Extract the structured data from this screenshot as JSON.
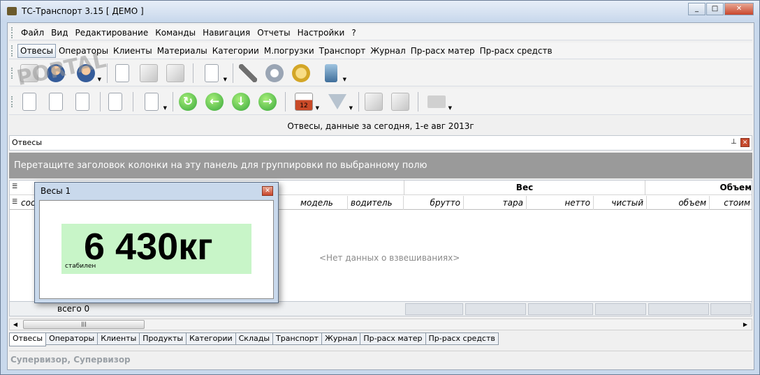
{
  "window": {
    "title": "ТС-Транспорт 3.15 [ ДЕМО ]",
    "min": "_",
    "max": "□",
    "close": "✕"
  },
  "menu": [
    "Файл",
    "Вид",
    "Редактирование",
    "Команды",
    "Навигация",
    "Отчеты",
    "Настройки",
    "?"
  ],
  "nav": [
    "Отвесы",
    "Операторы",
    "Клиенты",
    "Материалы",
    "Категории",
    "М.погрузки",
    "Транспорт",
    "Журнал",
    "Пр-расх матер",
    "Пр-расх средств"
  ],
  "header": {
    "title": "Отвесы, данные  за сегодня, 1-е авг 2013г"
  },
  "panel": {
    "caption": "Отвесы",
    "pin": "⊥",
    "close": "✕"
  },
  "group_bar": "Перетащите заголовок колонки на эту панель для группировки по выбранному полю",
  "grid": {
    "bands": {
      "ves": "Вес",
      "obj": "Объем"
    },
    "columns": [
      "сос",
      "модель",
      "водитель",
      "брутто",
      "тара",
      "нетто",
      "чистый",
      "объем",
      "стоим"
    ],
    "empty": "<Нет данных о взвешиваниях>"
  },
  "footer": {
    "total": "всего 0"
  },
  "scroll": {
    "left": "◀",
    "right": "▶",
    "grip": "|||"
  },
  "tabs": [
    "Отвесы",
    "Операторы",
    "Клиенты",
    "Продукты",
    "Категории",
    "Склады",
    "Транспорт",
    "Журнал",
    "Пр-расх матер",
    "Пр-расх средств"
  ],
  "status": {
    "user": "Супервизор, Супервизор"
  },
  "scale": {
    "title": "Весы 1",
    "value": "6 430кг",
    "state": "стабилен",
    "close": "✕"
  },
  "toolbar": {
    "calendar": "12",
    "nav_glyphs": [
      "↻",
      "←",
      "↓",
      "→"
    ]
  },
  "watermark": "PORTAL"
}
